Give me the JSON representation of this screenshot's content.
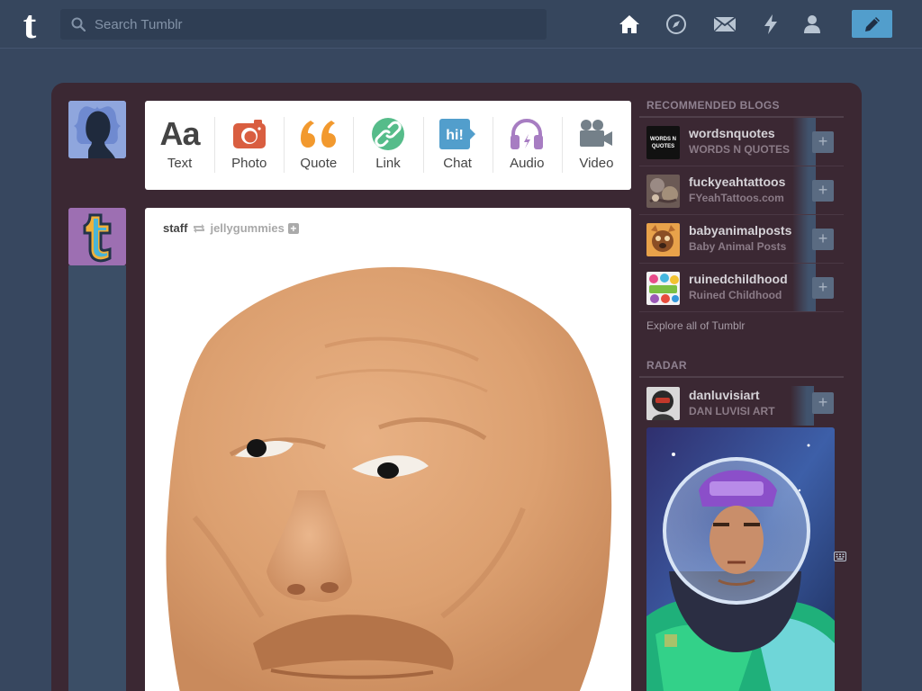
{
  "app": {
    "name": "Tumblr",
    "logo_letter": "t",
    "accent": "#529ecc",
    "background": "#36465d"
  },
  "search": {
    "placeholder": "Search Tumblr",
    "value": ""
  },
  "nav": {
    "items": [
      {
        "name": "home",
        "icon": "home-icon"
      },
      {
        "name": "explore",
        "icon": "compass-icon"
      },
      {
        "name": "inbox",
        "icon": "envelope-icon"
      },
      {
        "name": "activity",
        "icon": "lightning-icon"
      },
      {
        "name": "account",
        "icon": "person-icon"
      }
    ],
    "compose_icon": "pencil-icon"
  },
  "post_types": [
    {
      "label": "Text",
      "icon": "text-icon",
      "color": "#444444"
    },
    {
      "label": "Photo",
      "icon": "camera-icon",
      "color": "#d95e40"
    },
    {
      "label": "Quote",
      "icon": "quote-icon",
      "color": "#f2992e"
    },
    {
      "label": "Link",
      "icon": "link-icon",
      "color": "#56bc8a"
    },
    {
      "label": "Chat",
      "icon": "chat-icon",
      "color": "#529ecc"
    },
    {
      "label": "Audio",
      "icon": "headphones-icon",
      "color": "#a77dc2"
    },
    {
      "label": "Video",
      "icon": "video-camera-icon",
      "color": "#748089"
    }
  ],
  "post": {
    "author": "staff",
    "reblogged_from": "jellygummies",
    "follow_symbol": "+",
    "reblog_icon": "reblog-icon"
  },
  "sidebar": {
    "recommended_heading": "RECOMMENDED BLOGS",
    "blogs": [
      {
        "name": "wordsnquotes",
        "title": "WORDS N QUOTES",
        "thumb_text": "WORDS N QUOTES"
      },
      {
        "name": "fuckyeahtattoos",
        "title": "FYeahTattoos.com"
      },
      {
        "name": "babyanimalposts",
        "title": "Baby Animal Posts"
      },
      {
        "name": "ruinedchildhood",
        "title": "Ruined Childhood"
      }
    ],
    "explore_link": "Explore all of Tumblr",
    "radar_heading": "RADAR",
    "radar": {
      "name": "danluvisiart",
      "title": "DAN LUVISI ART"
    },
    "follow_symbol": "+"
  }
}
